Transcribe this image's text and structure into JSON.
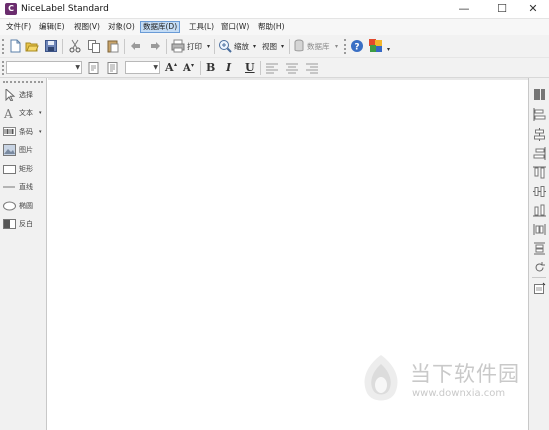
{
  "window": {
    "title": "NiceLabel Standard",
    "icon_letter": "C",
    "minimize": "—",
    "maximize": "☐",
    "close": "✕"
  },
  "menu": [
    {
      "label": "文件(F)",
      "active": false
    },
    {
      "label": "编辑(E)",
      "active": false
    },
    {
      "label": "视图(V)",
      "active": false
    },
    {
      "label": "对象(O)",
      "active": false
    },
    {
      "label": "数据库(D)",
      "active": true
    },
    {
      "label": "工具(L)",
      "active": false
    },
    {
      "label": "窗口(W)",
      "active": false
    },
    {
      "label": "帮助(H)",
      "active": false
    }
  ],
  "toolbar1": {
    "icons": [
      "new-document-icon",
      "open-folder-icon",
      "save-icon",
      "cut-icon",
      "copy-icon",
      "paste-icon",
      "undo-icon",
      "redo-icon",
      "printer-icon",
      "zoom-icon",
      "database-icon",
      "help-icon",
      "wizard-icon"
    ],
    "print_label": "打印",
    "zoom_label": "缩放",
    "view_label": "视图",
    "database_label": "数据库"
  },
  "toolbar2": {
    "font_name": "",
    "font_size": "",
    "grow_font": "A",
    "shrink_font": "A",
    "bold": "B",
    "italic": "I",
    "underline": "U"
  },
  "tools": [
    {
      "label": "选择",
      "icon": "pointer-icon"
    },
    {
      "label": "文本",
      "icon": "text-icon"
    },
    {
      "label": "条码",
      "icon": "barcode-icon"
    },
    {
      "label": "图片",
      "icon": "picture-icon"
    },
    {
      "label": "矩形",
      "icon": "rectangle-icon"
    },
    {
      "label": "直线",
      "icon": "line-icon"
    },
    {
      "label": "椭圆",
      "icon": "ellipse-icon"
    },
    {
      "label": "反白",
      "icon": "inverse-icon"
    }
  ],
  "right_tools": [
    "barcode-bars-icon",
    "align-left-icon",
    "align-center-icon",
    "align-right-icon",
    "align-top-icon",
    "align-middle-icon",
    "align-bottom-icon",
    "distribute-horizontal-icon",
    "distribute-vertical-icon",
    "rotate-icon",
    "properties-icon"
  ],
  "watermark": {
    "cn_text": "当下软件园",
    "url": "www.downxia.com"
  },
  "colors": {
    "menu_active_bg": "#c4dcf5",
    "menu_active_border": "#6a9bd6",
    "toolbar_bg": "#f2f2f2",
    "app_icon": "#6b2d6e"
  }
}
